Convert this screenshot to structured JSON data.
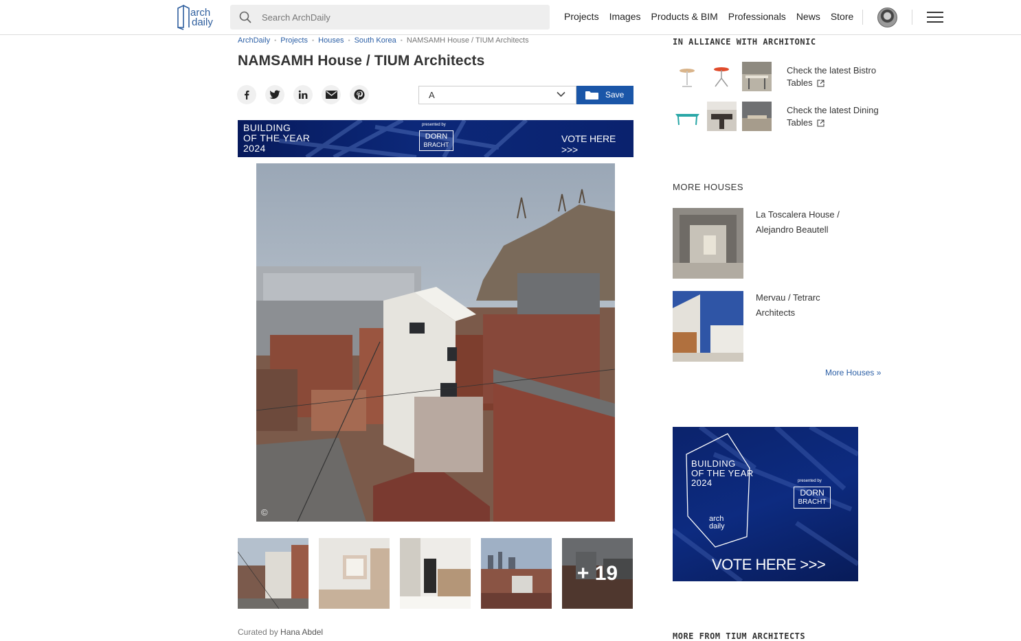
{
  "header": {
    "logo": {
      "line1": "arch",
      "line2": "daily"
    },
    "search_placeholder": "Search ArchDaily",
    "nav": [
      {
        "label": "Projects"
      },
      {
        "label": "Images"
      },
      {
        "label": "Products & BIM"
      },
      {
        "label": "Professionals"
      },
      {
        "label": "News"
      },
      {
        "label": "Store"
      }
    ]
  },
  "breadcrumb": [
    "ArchDaily",
    "Projects",
    "Houses",
    "South Korea",
    "NAMSAMH House / TIUM Architects"
  ],
  "article": {
    "title": "NAMSAMH House / TIUM Architects",
    "folder_value": "A",
    "save_label": "Save",
    "share_icons": [
      "facebook-icon",
      "twitter-icon",
      "linkedin-icon",
      "email-icon",
      "pinterest-icon"
    ],
    "copyright_mark": "©",
    "more_photos": "+ 19",
    "curated_prefix": "Curated by",
    "curator": "Hana Abdel"
  },
  "banner": {
    "line1": "BUILDING",
    "line2": "OF THE YEAR",
    "line3": "2024",
    "presented_by": "presented by",
    "brand_line1": "DORN",
    "brand_line2": "BRACHT",
    "cta": "VOTE HERE >>>"
  },
  "sidebar": {
    "alliance_heading": "IN ALLIANCE WITH ARCHITONIC",
    "alliance_links": [
      {
        "text": "Check the latest Bistro Tables"
      },
      {
        "text": "Check the latest Dining Tables"
      }
    ],
    "more_heading": "MORE HOUSES",
    "more_items": [
      {
        "title": "La Toscalera House / Alejandro Beautell"
      },
      {
        "title": "Mervau / Tetrarc Architects"
      }
    ],
    "more_link": "More Houses »",
    "ad": {
      "line1": "BUILDING",
      "line2": "OF THE YEAR",
      "line3": "2024",
      "presented_by": "presented by",
      "brand_line1": "DORN",
      "brand_line2": "BRACHT",
      "logo_line1": "arch",
      "logo_line2": "daily",
      "cta": "VOTE HERE >>>"
    },
    "bottom_heading": "MORE FROM TIUM ARCHITECTS"
  }
}
